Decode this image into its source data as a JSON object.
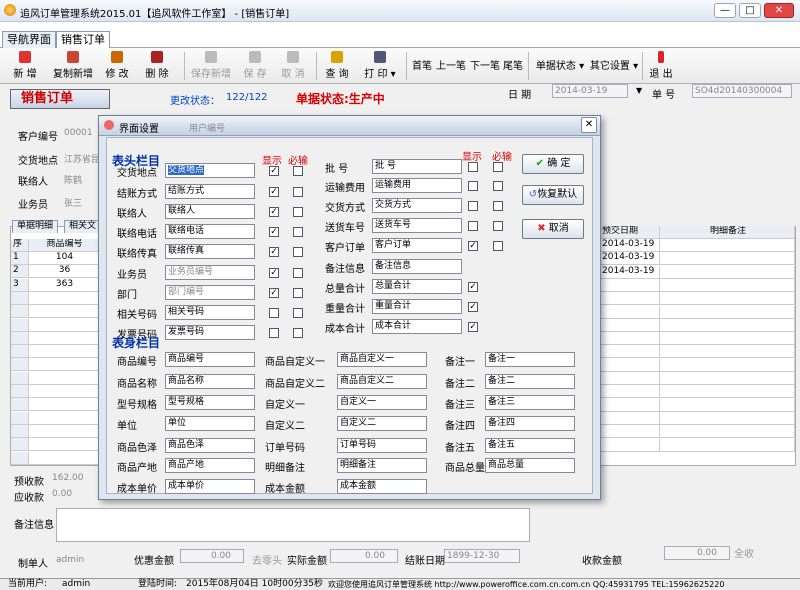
{
  "window": {
    "title": "追风订单管理系统2015.01【追风软件工作室】 - [销售订单]",
    "min": "—",
    "max": "□",
    "close": "✕"
  },
  "tabs": [
    "导航界面",
    "销售订单"
  ],
  "toolbar": {
    "new": "新 增",
    "copy_new": "复制新增",
    "edit": "修 改",
    "delete": "删 除",
    "save_new": "保存新增",
    "save": "保 存",
    "cancel": "取 消",
    "query": "查 询",
    "print": "打 印",
    "first": "首笔",
    "prev": "上一笔",
    "next": "下一笔",
    "last": "尾笔",
    "doc_status": "单据状态",
    "other": "其它设置",
    "exit": "退 出"
  },
  "order": {
    "title": "销售订单",
    "change_status_label": "更改状态：",
    "change_status": "122/122",
    "doc_status": "单据状态:生产中",
    "date_label": "日  期",
    "date": "2014-03-19",
    "num_label": "单  号",
    "num": "SO4d20140300004"
  },
  "header_fields": {
    "customer_no_label": "客户编号",
    "customer_no": "00001",
    "delivery_label": "交货地点",
    "delivery": "江苏省昆",
    "contact_label": "联络人",
    "contact": "陈鹤",
    "salesman_label": "业务员",
    "salesman": "张三"
  },
  "grid": {
    "tabs": [
      "单据明细",
      "相关文"
    ],
    "cols": [
      "序",
      "商品编号"
    ],
    "right_cols": [
      "预交日期",
      "明细备注"
    ],
    "rows": [
      {
        "n": "1",
        "code": "104",
        "date": "2014-03-19"
      },
      {
        "n": "2",
        "code": "36",
        "date": "2014-03-19"
      },
      {
        "n": "3",
        "code": "363",
        "date": "2014-03-19"
      }
    ]
  },
  "bottom": {
    "prepaid_label": "预收款",
    "prepaid": "162.00",
    "receivable_label": "应收款",
    "receivable": "0.00",
    "remark_label": "备注信息",
    "maker_label": "制单人",
    "maker": "admin",
    "discount_label": "优惠金额",
    "discount": "0.00",
    "zero_label": "去零头",
    "actual_label": "实际金额",
    "actual": "0.00",
    "settle_label": "结账日期",
    "settle": "1899-12-30",
    "collect_label": "收款金额",
    "collect": "0.00",
    "all_label": "全收"
  },
  "status": {
    "user_label": "当前用户:",
    "user": "admin",
    "login_label": "登陆时间:",
    "login": "2015年08月04日 10时00分35秒",
    "welcome": "欢迎您使用追风订单管理系统 http://www.poweroffice.com.cn.com.cn QQ:45931795 TEL:15962625220"
  },
  "dialog": {
    "title": "界面设置",
    "bg_title": "用户编号",
    "sec_head": "表头栏目",
    "sec_body": "表身栏目",
    "show": "显示",
    "required": "必输",
    "ok": "确  定",
    "default": "恢复默认",
    "cancel": "取消",
    "head_left": [
      {
        "label": "交货地点",
        "value": "交货地点",
        "show": true,
        "req": false,
        "sel": true
      },
      {
        "label": "结账方式",
        "value": "结账方式",
        "show": true,
        "req": false
      },
      {
        "label": "联络人",
        "value": "联络人",
        "show": true,
        "req": false
      },
      {
        "label": "联络电话",
        "value": "联络电话",
        "show": true,
        "req": false
      },
      {
        "label": "联络传真",
        "value": "联络传真",
        "show": true,
        "req": false
      },
      {
        "label": "业务员",
        "value": "业务员编号",
        "show": true,
        "req": false,
        "gray": true
      },
      {
        "label": "部门",
        "value": "部门编号",
        "show": true,
        "req": false,
        "gray": true
      },
      {
        "label": "相关号码",
        "value": "相关号码",
        "show": false,
        "req": false
      },
      {
        "label": "发票号码",
        "value": "发票号码",
        "show": false,
        "req": false
      }
    ],
    "head_right": [
      {
        "label": "批    号",
        "value": "批    号",
        "show": false,
        "req": false
      },
      {
        "label": "运输费用",
        "value": "运输费用",
        "show": false,
        "req": false
      },
      {
        "label": "交货方式",
        "value": "交货方式",
        "show": false,
        "req": false
      },
      {
        "label": "送货车号",
        "value": "送货车号",
        "show": false,
        "req": false
      },
      {
        "label": "客户订单",
        "value": "客户订单",
        "show": true,
        "req": false
      },
      {
        "label": "备注信息",
        "value": "备注信息"
      },
      {
        "label": "总量合计",
        "value": "总量合计",
        "show": true
      },
      {
        "label": "重量合计",
        "value": "重量合计",
        "show": true
      },
      {
        "label": "成本合计",
        "value": "成本合计",
        "show": true
      }
    ],
    "body_c1": [
      [
        "商品编号",
        "商品编号"
      ],
      [
        "商品名称",
        "商品名称"
      ],
      [
        "型号规格",
        "型号规格"
      ],
      [
        "单位",
        "单位"
      ],
      [
        "商品色泽",
        "商品色泽"
      ],
      [
        "商品产地",
        "商品产地"
      ],
      [
        "成本单价",
        "成本单价"
      ]
    ],
    "body_c2": [
      [
        "商品自定义一",
        "商品自定义一"
      ],
      [
        "商品自定义二",
        "商品自定义二"
      ],
      [
        "自定义一",
        "自定义一"
      ],
      [
        "自定义二",
        "自定义二"
      ],
      [
        "订单号码",
        "订单号码"
      ],
      [
        "明细备注",
        "明细备注"
      ],
      [
        "成本金额",
        "成本金额"
      ]
    ],
    "body_c3": [
      [
        "备注一",
        "备注一"
      ],
      [
        "备注二",
        "备注二"
      ],
      [
        "备注三",
        "备注三"
      ],
      [
        "备注四",
        "备注四"
      ],
      [
        "备注五",
        "备注五"
      ],
      [
        "商品总量",
        "商品总量"
      ]
    ]
  }
}
